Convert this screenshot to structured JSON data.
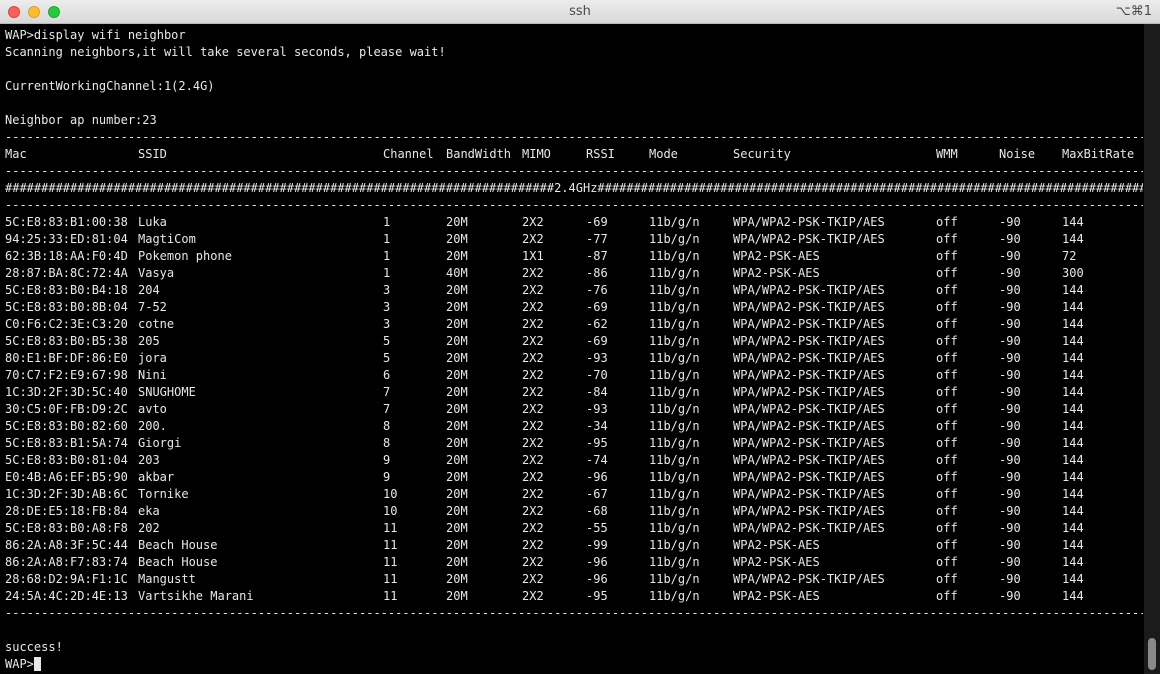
{
  "window": {
    "title": "ssh",
    "shortcut": "⌥⌘1"
  },
  "terminal": {
    "command_line": "WAP>display wifi neighbor",
    "scan_msg": "Scanning neighbors,it will take several seconds, please wait!",
    "channel_line": "CurrentWorkingChannel:1(2.4G)",
    "count_line": "Neighbor ap number:23",
    "separator": "--------------------------------------------------------------------------------------------------------------------------------------------------------------------------------------------------------------------",
    "band_line": "############################################################################2.4GHz##############################################################################################################################",
    "headers": [
      "Mac",
      "SSID",
      "Channel",
      "BandWidth",
      "MIMO",
      "RSSI",
      "Mode",
      "Security",
      "WMM",
      "Noise",
      "MaxBitRate"
    ],
    "rows": [
      [
        "5C:E8:83:B1:00:38",
        "Luka",
        "1",
        "20M",
        "2X2",
        "-69",
        "11b/g/n",
        "WPA/WPA2-PSK-TKIP/AES",
        "off",
        "-90",
        "144"
      ],
      [
        "94:25:33:ED:81:04",
        "MagtiCom",
        "1",
        "20M",
        "2X2",
        "-77",
        "11b/g/n",
        "WPA/WPA2-PSK-TKIP/AES",
        "off",
        "-90",
        "144"
      ],
      [
        "62:3B:18:AA:F0:4D",
        "Pokemon phone",
        "1",
        "20M",
        "1X1",
        "-87",
        "11b/g/n",
        "WPA2-PSK-AES",
        "off",
        "-90",
        "72"
      ],
      [
        "28:87:BA:8C:72:4A",
        "Vasya",
        "1",
        "40M",
        "2X2",
        "-86",
        "11b/g/n",
        "WPA2-PSK-AES",
        "off",
        "-90",
        "300"
      ],
      [
        "5C:E8:83:B0:B4:18",
        "204",
        "3",
        "20M",
        "2X2",
        "-76",
        "11b/g/n",
        "WPA/WPA2-PSK-TKIP/AES",
        "off",
        "-90",
        "144"
      ],
      [
        "5C:E8:83:B0:8B:04",
        "7-52",
        "3",
        "20M",
        "2X2",
        "-69",
        "11b/g/n",
        "WPA/WPA2-PSK-TKIP/AES",
        "off",
        "-90",
        "144"
      ],
      [
        "C0:F6:C2:3E:C3:20",
        "cotne",
        "3",
        "20M",
        "2X2",
        "-62",
        "11b/g/n",
        "WPA/WPA2-PSK-TKIP/AES",
        "off",
        "-90",
        "144"
      ],
      [
        "5C:E8:83:B0:B5:38",
        "205",
        "5",
        "20M",
        "2X2",
        "-69",
        "11b/g/n",
        "WPA/WPA2-PSK-TKIP/AES",
        "off",
        "-90",
        "144"
      ],
      [
        "80:E1:BF:DF:86:E0",
        "jora",
        "5",
        "20M",
        "2X2",
        "-93",
        "11b/g/n",
        "WPA/WPA2-PSK-TKIP/AES",
        "off",
        "-90",
        "144"
      ],
      [
        "70:C7:F2:E9:67:98",
        "Nini",
        "6",
        "20M",
        "2X2",
        "-70",
        "11b/g/n",
        "WPA/WPA2-PSK-TKIP/AES",
        "off",
        "-90",
        "144"
      ],
      [
        "1C:3D:2F:3D:5C:40",
        "SNUGHOME",
        "7",
        "20M",
        "2X2",
        "-84",
        "11b/g/n",
        "WPA/WPA2-PSK-TKIP/AES",
        "off",
        "-90",
        "144"
      ],
      [
        "30:C5:0F:FB:D9:2C",
        "avto",
        "7",
        "20M",
        "2X2",
        "-93",
        "11b/g/n",
        "WPA/WPA2-PSK-TKIP/AES",
        "off",
        "-90",
        "144"
      ],
      [
        "5C:E8:83:B0:82:60",
        "200.",
        "8",
        "20M",
        "2X2",
        "-34",
        "11b/g/n",
        "WPA/WPA2-PSK-TKIP/AES",
        "off",
        "-90",
        "144"
      ],
      [
        "5C:E8:83:B1:5A:74",
        "Giorgi",
        "8",
        "20M",
        "2X2",
        "-95",
        "11b/g/n",
        "WPA/WPA2-PSK-TKIP/AES",
        "off",
        "-90",
        "144"
      ],
      [
        "5C:E8:83:B0:81:04",
        "203",
        "9",
        "20M",
        "2X2",
        "-74",
        "11b/g/n",
        "WPA/WPA2-PSK-TKIP/AES",
        "off",
        "-90",
        "144"
      ],
      [
        "E0:4B:A6:EF:B5:90",
        "akbar",
        "9",
        "20M",
        "2X2",
        "-96",
        "11b/g/n",
        "WPA/WPA2-PSK-TKIP/AES",
        "off",
        "-90",
        "144"
      ],
      [
        "1C:3D:2F:3D:AB:6C",
        "Tornike",
        "10",
        "20M",
        "2X2",
        "-67",
        "11b/g/n",
        "WPA/WPA2-PSK-TKIP/AES",
        "off",
        "-90",
        "144"
      ],
      [
        "28:DE:E5:18:FB:84",
        "eka",
        "10",
        "20M",
        "2X2",
        "-68",
        "11b/g/n",
        "WPA/WPA2-PSK-TKIP/AES",
        "off",
        "-90",
        "144"
      ],
      [
        "5C:E8:83:B0:A8:F8",
        "202",
        "11",
        "20M",
        "2X2",
        "-55",
        "11b/g/n",
        "WPA/WPA2-PSK-TKIP/AES",
        "off",
        "-90",
        "144"
      ],
      [
        "86:2A:A8:3F:5C:44",
        "Beach House",
        "11",
        "20M",
        "2X2",
        "-99",
        "11b/g/n",
        "WPA2-PSK-AES",
        "off",
        "-90",
        "144"
      ],
      [
        "86:2A:A8:F7:83:74",
        "Beach House",
        "11",
        "20M",
        "2X2",
        "-96",
        "11b/g/n",
        "WPA2-PSK-AES",
        "off",
        "-90",
        "144"
      ],
      [
        "28:68:D2:9A:F1:1C",
        "Mangustt",
        "11",
        "20M",
        "2X2",
        "-96",
        "11b/g/n",
        "WPA/WPA2-PSK-TKIP/AES",
        "off",
        "-90",
        "144"
      ],
      [
        "24:5A:4C:2D:4E:13",
        "Vartsikhe Marani",
        "11",
        "20M",
        "2X2",
        "-95",
        "11b/g/n",
        "WPA2-PSK-AES",
        "off",
        "-90",
        "144"
      ]
    ],
    "success_msg": "success!",
    "prompt": "WAP>"
  }
}
